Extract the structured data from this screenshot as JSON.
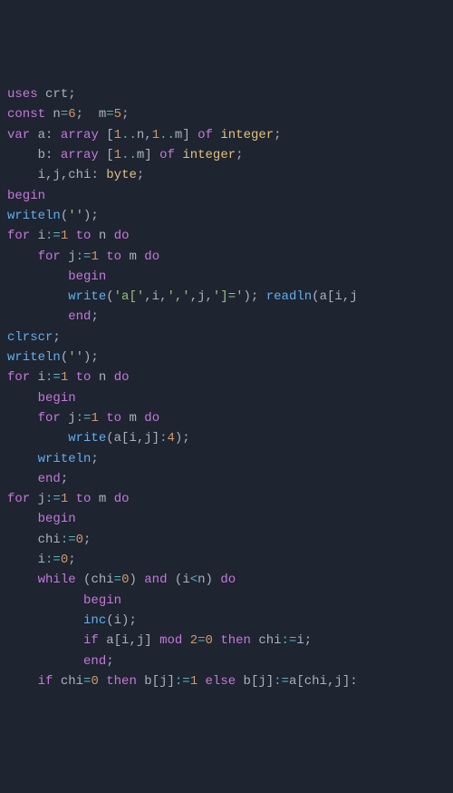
{
  "lines": [
    [
      {
        "cls": "kw",
        "t": "uses"
      },
      {
        "cls": "id",
        "t": " crt"
      },
      {
        "cls": "punct",
        "t": ";"
      }
    ],
    [
      {
        "cls": "kw",
        "t": "const"
      },
      {
        "cls": "id",
        "t": " n"
      },
      {
        "cls": "op",
        "t": "="
      },
      {
        "cls": "num",
        "t": "6"
      },
      {
        "cls": "punct",
        "t": "; "
      },
      {
        "cls": "id",
        "t": " m"
      },
      {
        "cls": "op",
        "t": "="
      },
      {
        "cls": "num",
        "t": "5"
      },
      {
        "cls": "punct",
        "t": ";"
      }
    ],
    [
      {
        "cls": "kw",
        "t": "var"
      },
      {
        "cls": "id",
        "t": " a"
      },
      {
        "cls": "punct",
        "t": ": "
      },
      {
        "cls": "kw",
        "t": "array"
      },
      {
        "cls": "punct",
        "t": " ["
      },
      {
        "cls": "num",
        "t": "1"
      },
      {
        "cls": "op",
        "t": ".."
      },
      {
        "cls": "id",
        "t": "n"
      },
      {
        "cls": "punct",
        "t": ","
      },
      {
        "cls": "num",
        "t": "1"
      },
      {
        "cls": "op",
        "t": ".."
      },
      {
        "cls": "id",
        "t": "m"
      },
      {
        "cls": "punct",
        "t": "] "
      },
      {
        "cls": "kw",
        "t": "of"
      },
      {
        "cls": "id",
        "t": " "
      },
      {
        "cls": "type",
        "t": "integer"
      },
      {
        "cls": "punct",
        "t": ";"
      }
    ],
    [
      {
        "cls": "id",
        "t": "    b"
      },
      {
        "cls": "punct",
        "t": ": "
      },
      {
        "cls": "kw",
        "t": "array"
      },
      {
        "cls": "punct",
        "t": " ["
      },
      {
        "cls": "num",
        "t": "1"
      },
      {
        "cls": "op",
        "t": ".."
      },
      {
        "cls": "id",
        "t": "m"
      },
      {
        "cls": "punct",
        "t": "] "
      },
      {
        "cls": "kw",
        "t": "of"
      },
      {
        "cls": "id",
        "t": " "
      },
      {
        "cls": "type",
        "t": "integer"
      },
      {
        "cls": "punct",
        "t": ";"
      }
    ],
    [
      {
        "cls": "id",
        "t": "    i"
      },
      {
        "cls": "punct",
        "t": ","
      },
      {
        "cls": "id",
        "t": "j"
      },
      {
        "cls": "punct",
        "t": ","
      },
      {
        "cls": "id",
        "t": "chi"
      },
      {
        "cls": "punct",
        "t": ": "
      },
      {
        "cls": "type",
        "t": "byte"
      },
      {
        "cls": "punct",
        "t": ";"
      }
    ],
    [
      {
        "cls": "kw",
        "t": "begin"
      }
    ],
    [
      {
        "cls": "fn",
        "t": "writeln"
      },
      {
        "cls": "punct",
        "t": "("
      },
      {
        "cls": "str",
        "t": "''"
      },
      {
        "cls": "punct",
        "t": ");"
      }
    ],
    [
      {
        "cls": "kw",
        "t": "for"
      },
      {
        "cls": "id",
        "t": " i"
      },
      {
        "cls": "op",
        "t": ":="
      },
      {
        "cls": "num",
        "t": "1"
      },
      {
        "cls": "id",
        "t": " "
      },
      {
        "cls": "kw",
        "t": "to"
      },
      {
        "cls": "id",
        "t": " n "
      },
      {
        "cls": "kw",
        "t": "do"
      }
    ],
    [
      {
        "cls": "id",
        "t": "    "
      },
      {
        "cls": "kw",
        "t": "for"
      },
      {
        "cls": "id",
        "t": " j"
      },
      {
        "cls": "op",
        "t": ":="
      },
      {
        "cls": "num",
        "t": "1"
      },
      {
        "cls": "id",
        "t": " "
      },
      {
        "cls": "kw",
        "t": "to"
      },
      {
        "cls": "id",
        "t": " m "
      },
      {
        "cls": "kw",
        "t": "do"
      }
    ],
    [
      {
        "cls": "id",
        "t": "        "
      },
      {
        "cls": "kw",
        "t": "begin"
      }
    ],
    [
      {
        "cls": "id",
        "t": "        "
      },
      {
        "cls": "fn",
        "t": "write"
      },
      {
        "cls": "punct",
        "t": "("
      },
      {
        "cls": "str",
        "t": "'a['"
      },
      {
        "cls": "punct",
        "t": ","
      },
      {
        "cls": "id",
        "t": "i"
      },
      {
        "cls": "punct",
        "t": ","
      },
      {
        "cls": "str",
        "t": "','"
      },
      {
        "cls": "punct",
        "t": ","
      },
      {
        "cls": "id",
        "t": "j"
      },
      {
        "cls": "punct",
        "t": ","
      },
      {
        "cls": "str",
        "t": "']='"
      },
      {
        "cls": "punct",
        "t": "); "
      },
      {
        "cls": "fn",
        "t": "readln"
      },
      {
        "cls": "punct",
        "t": "("
      },
      {
        "cls": "id",
        "t": "a"
      },
      {
        "cls": "punct",
        "t": "["
      },
      {
        "cls": "id",
        "t": "i"
      },
      {
        "cls": "punct",
        "t": ","
      },
      {
        "cls": "id",
        "t": "j"
      }
    ],
    [
      {
        "cls": "id",
        "t": "        "
      },
      {
        "cls": "kw",
        "t": "end"
      },
      {
        "cls": "punct",
        "t": ";"
      }
    ],
    [
      {
        "cls": "fn",
        "t": "clrscr"
      },
      {
        "cls": "punct",
        "t": ";"
      }
    ],
    [
      {
        "cls": "fn",
        "t": "writeln"
      },
      {
        "cls": "punct",
        "t": "("
      },
      {
        "cls": "str",
        "t": "''"
      },
      {
        "cls": "punct",
        "t": ");"
      }
    ],
    [
      {
        "cls": "kw",
        "t": "for"
      },
      {
        "cls": "id",
        "t": " i"
      },
      {
        "cls": "op",
        "t": ":="
      },
      {
        "cls": "num",
        "t": "1"
      },
      {
        "cls": "id",
        "t": " "
      },
      {
        "cls": "kw",
        "t": "to"
      },
      {
        "cls": "id",
        "t": " n "
      },
      {
        "cls": "kw",
        "t": "do"
      }
    ],
    [
      {
        "cls": "id",
        "t": "    "
      },
      {
        "cls": "kw",
        "t": "begin"
      }
    ],
    [
      {
        "cls": "id",
        "t": "    "
      },
      {
        "cls": "kw",
        "t": "for"
      },
      {
        "cls": "id",
        "t": " j"
      },
      {
        "cls": "op",
        "t": ":="
      },
      {
        "cls": "num",
        "t": "1"
      },
      {
        "cls": "id",
        "t": " "
      },
      {
        "cls": "kw",
        "t": "to"
      },
      {
        "cls": "id",
        "t": " m "
      },
      {
        "cls": "kw",
        "t": "do"
      }
    ],
    [
      {
        "cls": "id",
        "t": "        "
      },
      {
        "cls": "fn",
        "t": "write"
      },
      {
        "cls": "punct",
        "t": "("
      },
      {
        "cls": "id",
        "t": "a"
      },
      {
        "cls": "punct",
        "t": "["
      },
      {
        "cls": "id",
        "t": "i"
      },
      {
        "cls": "punct",
        "t": ","
      },
      {
        "cls": "id",
        "t": "j"
      },
      {
        "cls": "punct",
        "t": "]"
      },
      {
        "cls": "op",
        "t": ":"
      },
      {
        "cls": "num",
        "t": "4"
      },
      {
        "cls": "punct",
        "t": ");"
      }
    ],
    [
      {
        "cls": "id",
        "t": "    "
      },
      {
        "cls": "fn",
        "t": "writeln"
      },
      {
        "cls": "punct",
        "t": ";"
      }
    ],
    [
      {
        "cls": "id",
        "t": "    "
      },
      {
        "cls": "kw",
        "t": "end"
      },
      {
        "cls": "punct",
        "t": ";"
      }
    ],
    [
      {
        "cls": "kw",
        "t": "for"
      },
      {
        "cls": "id",
        "t": " j"
      },
      {
        "cls": "op",
        "t": ":="
      },
      {
        "cls": "num",
        "t": "1"
      },
      {
        "cls": "id",
        "t": " "
      },
      {
        "cls": "kw",
        "t": "to"
      },
      {
        "cls": "id",
        "t": " m "
      },
      {
        "cls": "kw",
        "t": "do"
      }
    ],
    [
      {
        "cls": "id",
        "t": "    "
      },
      {
        "cls": "kw",
        "t": "begin"
      }
    ],
    [
      {
        "cls": "id",
        "t": "    chi"
      },
      {
        "cls": "op",
        "t": ":="
      },
      {
        "cls": "num",
        "t": "0"
      },
      {
        "cls": "punct",
        "t": ";"
      }
    ],
    [
      {
        "cls": "id",
        "t": "    i"
      },
      {
        "cls": "op",
        "t": ":="
      },
      {
        "cls": "num",
        "t": "0"
      },
      {
        "cls": "punct",
        "t": ";"
      }
    ],
    [
      {
        "cls": "id",
        "t": "    "
      },
      {
        "cls": "kw",
        "t": "while"
      },
      {
        "cls": "id",
        "t": " "
      },
      {
        "cls": "punct",
        "t": "("
      },
      {
        "cls": "id",
        "t": "chi"
      },
      {
        "cls": "op",
        "t": "="
      },
      {
        "cls": "num",
        "t": "0"
      },
      {
        "cls": "punct",
        "t": ") "
      },
      {
        "cls": "kw",
        "t": "and"
      },
      {
        "cls": "id",
        "t": " "
      },
      {
        "cls": "punct",
        "t": "("
      },
      {
        "cls": "id",
        "t": "i"
      },
      {
        "cls": "op",
        "t": "<"
      },
      {
        "cls": "id",
        "t": "n"
      },
      {
        "cls": "punct",
        "t": ") "
      },
      {
        "cls": "kw",
        "t": "do"
      }
    ],
    [
      {
        "cls": "id",
        "t": "          "
      },
      {
        "cls": "kw",
        "t": "begin"
      }
    ],
    [
      {
        "cls": "id",
        "t": "          "
      },
      {
        "cls": "fn",
        "t": "inc"
      },
      {
        "cls": "punct",
        "t": "("
      },
      {
        "cls": "id",
        "t": "i"
      },
      {
        "cls": "punct",
        "t": ");"
      }
    ],
    [
      {
        "cls": "id",
        "t": "          "
      },
      {
        "cls": "kw",
        "t": "if"
      },
      {
        "cls": "id",
        "t": " a"
      },
      {
        "cls": "punct",
        "t": "["
      },
      {
        "cls": "id",
        "t": "i"
      },
      {
        "cls": "punct",
        "t": ","
      },
      {
        "cls": "id",
        "t": "j"
      },
      {
        "cls": "punct",
        "t": "] "
      },
      {
        "cls": "kw",
        "t": "mod"
      },
      {
        "cls": "id",
        "t": " "
      },
      {
        "cls": "num",
        "t": "2"
      },
      {
        "cls": "op",
        "t": "="
      },
      {
        "cls": "num",
        "t": "0"
      },
      {
        "cls": "id",
        "t": " "
      },
      {
        "cls": "kw",
        "t": "then"
      },
      {
        "cls": "id",
        "t": " chi"
      },
      {
        "cls": "op",
        "t": ":="
      },
      {
        "cls": "id",
        "t": "i"
      },
      {
        "cls": "punct",
        "t": ";"
      }
    ],
    [
      {
        "cls": "id",
        "t": "          "
      },
      {
        "cls": "kw",
        "t": "end"
      },
      {
        "cls": "punct",
        "t": ";"
      }
    ],
    [
      {
        "cls": "id",
        "t": "    "
      },
      {
        "cls": "kw",
        "t": "if"
      },
      {
        "cls": "id",
        "t": " chi"
      },
      {
        "cls": "op",
        "t": "="
      },
      {
        "cls": "num",
        "t": "0"
      },
      {
        "cls": "id",
        "t": " "
      },
      {
        "cls": "kw",
        "t": "then"
      },
      {
        "cls": "id",
        "t": " b"
      },
      {
        "cls": "punct",
        "t": "["
      },
      {
        "cls": "id",
        "t": "j"
      },
      {
        "cls": "punct",
        "t": "]"
      },
      {
        "cls": "op",
        "t": ":="
      },
      {
        "cls": "num",
        "t": "1"
      },
      {
        "cls": "id",
        "t": " "
      },
      {
        "cls": "kw",
        "t": "else"
      },
      {
        "cls": "id",
        "t": " b"
      },
      {
        "cls": "punct",
        "t": "["
      },
      {
        "cls": "id",
        "t": "j"
      },
      {
        "cls": "punct",
        "t": "]"
      },
      {
        "cls": "op",
        "t": ":="
      },
      {
        "cls": "id",
        "t": "a"
      },
      {
        "cls": "punct",
        "t": "["
      },
      {
        "cls": "id",
        "t": "chi"
      },
      {
        "cls": "punct",
        "t": ","
      },
      {
        "cls": "id",
        "t": "j"
      },
      {
        "cls": "punct",
        "t": "]:"
      }
    ]
  ]
}
